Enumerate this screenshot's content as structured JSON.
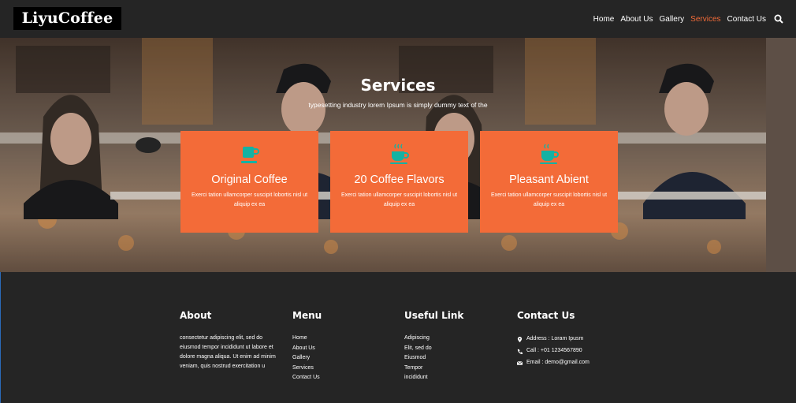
{
  "header": {
    "logo": "LiyuCoffee",
    "nav": [
      "Home",
      "About Us",
      "Gallery",
      "Services",
      "Contact Us"
    ],
    "active_nav": "Services",
    "search_icon": "search-icon"
  },
  "services": {
    "title": "Services",
    "subtitle": "typesetting industry lorem Ipsum is simply dummy text of the",
    "cards": [
      {
        "icon": "coffee-cup-icon",
        "title": "Original Coffee",
        "text": "Exerci tation ullamcorper suscipit lobortis nisl ut aliquip ex ea"
      },
      {
        "icon": "coffee-cup-icon",
        "title": "20 Coffee Flavors",
        "text": "Exerci tation ullamcorper suscipit lobortis nisl ut aliquip ex ea"
      },
      {
        "icon": "coffee-cup-icon",
        "title": "Pleasant Abient",
        "text": "Exerci tation ullamcorper suscipit lobortis nisl ut aliquip ex ea"
      }
    ]
  },
  "footer": {
    "about": {
      "title": "About",
      "text": "consectetur adipiscing elit, sed do eiusmod tempor incididunt ut labore et dolore magna aliqua. Ut enim ad minim veniam, quis nostrud exercitation u"
    },
    "menu": {
      "title": "Menu",
      "items": [
        "Home",
        "About Us",
        "Gallery",
        "Services",
        "Contact Us"
      ]
    },
    "useful": {
      "title": "Useful Link",
      "items": [
        "Adipiscing",
        "Elit, sed do",
        "Eiusmod",
        "Tempor",
        "incididunt"
      ]
    },
    "contact": {
      "title": "Contact Us",
      "address": "Address : Loram Ipusm",
      "call": "Call : +01 1234567890",
      "email": "Email : demo@gmail.com"
    }
  },
  "colors": {
    "accent": "#f36b38",
    "background": "#252525",
    "icon_teal": "#14b2a3"
  }
}
